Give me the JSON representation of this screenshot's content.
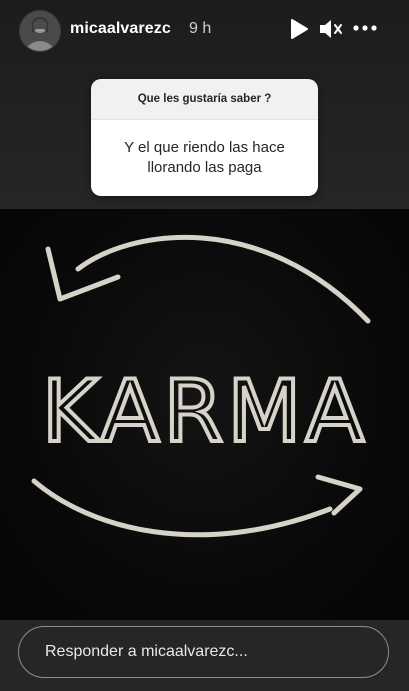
{
  "story": {
    "username": "micaalvarezc",
    "time_ago": "9 h"
  },
  "header_icons": {
    "play": "play-icon",
    "mute": "mute-icon",
    "more": "more-options-icon"
  },
  "question_sticker": {
    "question": "Que les gustaría saber ?",
    "answer_line1": "Y el que riendo las hace",
    "answer_line2": "llorando las paga"
  },
  "image": {
    "word": "KARMA"
  },
  "reply": {
    "placeholder": "Responder a micaalvarezc..."
  },
  "colors": {
    "background": "#262626",
    "card_top": "#f1f1f1",
    "card_body": "#ffffff",
    "chalk": "#e8e4d8"
  }
}
